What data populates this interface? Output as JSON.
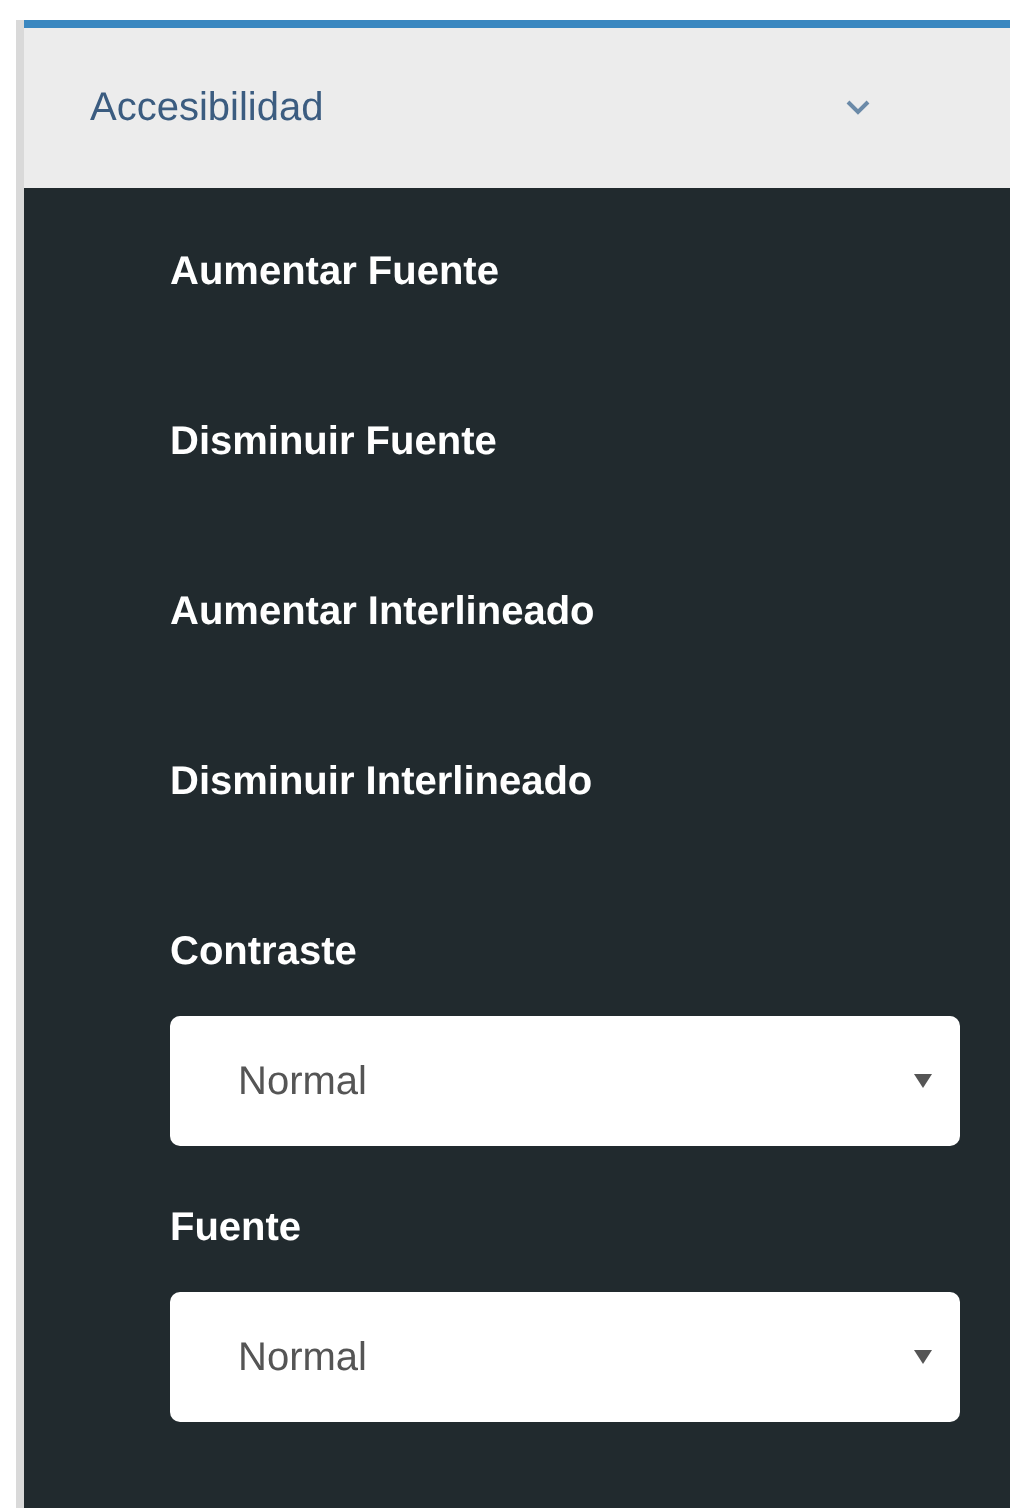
{
  "panel": {
    "title": "Accesibilidad"
  },
  "actions": [
    "Aumentar Fuente",
    "Disminuir Fuente",
    "Aumentar Interlineado",
    "Disminuir Interlineado"
  ],
  "selects": [
    {
      "label": "Contraste",
      "value": "Normal"
    },
    {
      "label": "Fuente",
      "value": "Normal"
    }
  ]
}
